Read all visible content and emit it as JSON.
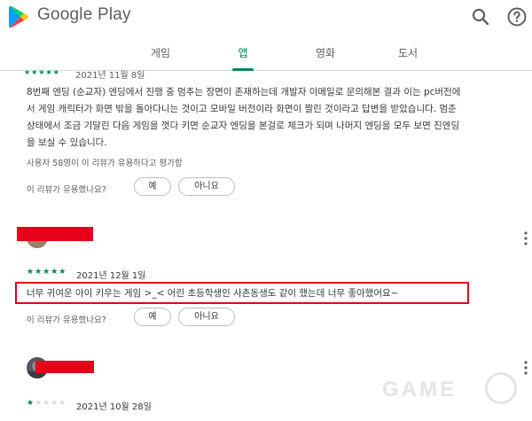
{
  "header": {
    "brand": "Google Play",
    "icons": {
      "logo": "google-play-logo",
      "search": "search-icon",
      "help": "help-icon"
    }
  },
  "tabs": [
    {
      "label": "게임"
    },
    {
      "label": "앱"
    },
    {
      "label": "영화"
    },
    {
      "label": "도서"
    }
  ],
  "reviews": [
    {
      "rating": 5,
      "date": "2021년 11월 8일",
      "text_lines": [
        "8번째 엔딩 (순교자) 엔딩에서 진행 중 멈추는 장면이 존재하는데 개발자 이메일로 문의해본 결과 이는 pc버전에",
        "서 게임 캐릭터가 화면 밖을 돌아다니는 것이고 모바일 버전이라 화면이 짤린 것이라고 답변을 받았습니다. 멈춘",
        "상태에서 조금 기달린 다음 게임을 껏다 키면 순교자 엔딩을 본걸로 체크가 되며 나머지 엔딩을 모두 보면 진엔딩",
        "을 보실 수 있습니다."
      ],
      "helpful_count_text": "사용자 58명이 이 리뷰가 유용하다고 평가함",
      "helpful_question": "이 리뷰가 유용했나요?",
      "yes_label": "예",
      "no_label": "아니요"
    },
    {
      "rating": 5,
      "date": "2021년 12월 1일",
      "text": "너무 귀여운 아이 키우는 게임 >_< 어린 초등학생인 사촌동생도 같이 했는데 너무 좋아했어요~",
      "helpful_question": "이 리뷰가 유용했나요?",
      "yes_label": "예",
      "no_label": "아니요"
    },
    {
      "rating": 1,
      "date": "2021년 10월 28일"
    }
  ],
  "colors": {
    "accent_green": "#01875f",
    "redaction_red": "#e8001a",
    "empty_star": "#dadce0"
  }
}
